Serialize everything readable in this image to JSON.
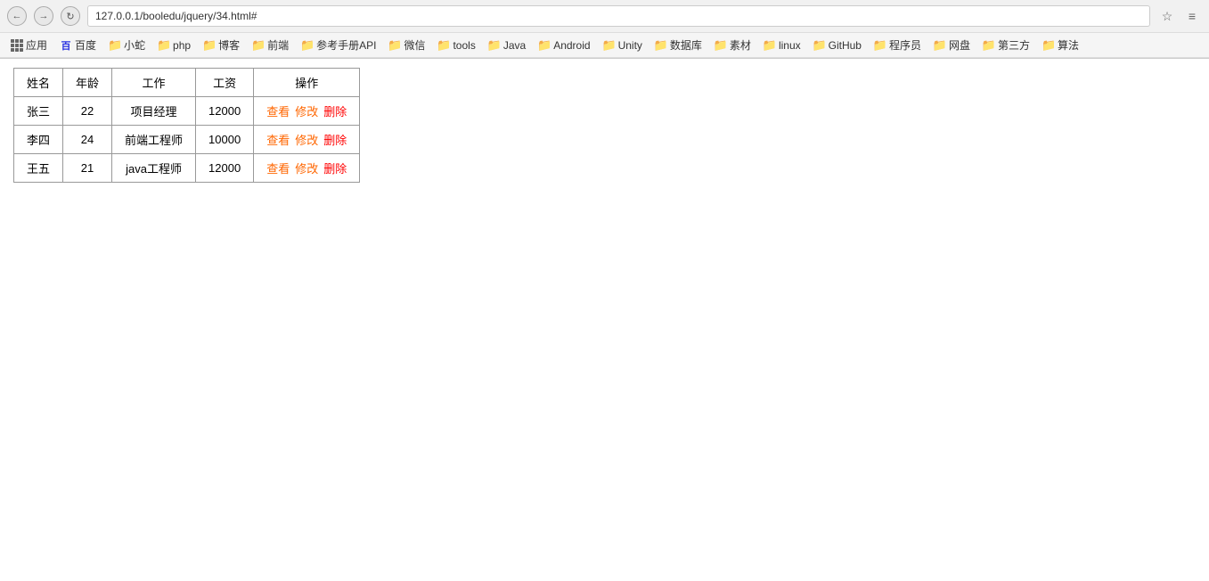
{
  "browser": {
    "address": "127.0.0.1/booledu/jquery/34.html#",
    "bookmarks": [
      {
        "label": "应用",
        "type": "apps"
      },
      {
        "label": "百度",
        "type": "baidu"
      },
      {
        "label": "小蛇",
        "type": "folder"
      },
      {
        "label": "php",
        "type": "folder"
      },
      {
        "label": "博客",
        "type": "folder"
      },
      {
        "label": "前端",
        "type": "folder"
      },
      {
        "label": "参考手册API",
        "type": "folder"
      },
      {
        "label": "微信",
        "type": "folder"
      },
      {
        "label": "tools",
        "type": "folder"
      },
      {
        "label": "Java",
        "type": "folder"
      },
      {
        "label": "Android",
        "type": "folder"
      },
      {
        "label": "Unity",
        "type": "folder"
      },
      {
        "label": "数据库",
        "type": "folder"
      },
      {
        "label": "素材",
        "type": "folder"
      },
      {
        "label": "linux",
        "type": "folder"
      },
      {
        "label": "GitHub",
        "type": "folder"
      },
      {
        "label": "程序员",
        "type": "folder"
      },
      {
        "label": "网盘",
        "type": "folder"
      },
      {
        "label": "第三方",
        "type": "folder"
      },
      {
        "label": "算法",
        "type": "folder"
      }
    ]
  },
  "table": {
    "headers": [
      "姓名",
      "年龄",
      "工作",
      "工资",
      "操作"
    ],
    "rows": [
      {
        "name": "张三",
        "age": "22",
        "job": "项目经理",
        "salary": "12000",
        "actions": [
          "查看",
          "修改",
          "删除"
        ]
      },
      {
        "name": "李四",
        "age": "24",
        "job": "前端工程师",
        "salary": "10000",
        "actions": [
          "查看",
          "修改",
          "删除"
        ]
      },
      {
        "name": "王五",
        "age": "21",
        "job": "java工程师",
        "salary": "12000",
        "actions": [
          "查看",
          "修改",
          "删除"
        ]
      }
    ]
  }
}
